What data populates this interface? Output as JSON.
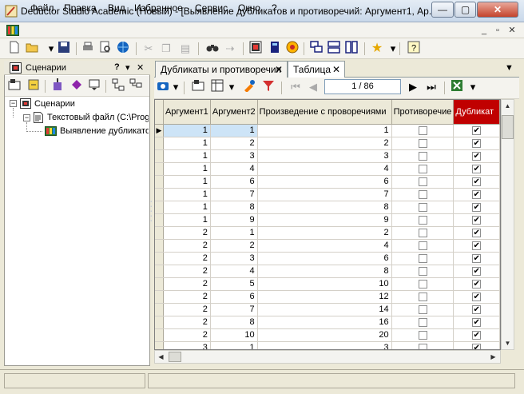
{
  "window": {
    "title": "Deductor Studio Academic (Новый) - [Выявление дубликатов и противоречий: Аргумент1, Ар...",
    "btn_min": "—",
    "btn_max": "▢",
    "btn_close": "✕"
  },
  "menu": [
    "Файл",
    "Правка",
    "Вид",
    "Избранное",
    "Сервис",
    "Окно",
    "?"
  ],
  "mdi_controls": [
    "_",
    "▫",
    "✕"
  ],
  "left_panel": {
    "title": "Сценарии",
    "controls": [
      "?",
      "▾",
      "✕"
    ],
    "tree": [
      {
        "label": "Сценарии",
        "expander": "⊟"
      },
      {
        "label": "Текстовый файл (C:\\Prog",
        "expander": "⊟"
      },
      {
        "label": "Выявление дубликатов"
      }
    ]
  },
  "tabs": [
    {
      "label": "Дубликаты и противоречия",
      "close": "✕"
    },
    {
      "label": "Таблица",
      "close": "✕"
    }
  ],
  "tabs_menu_icon": "▼",
  "pager": {
    "value": "1 / 86"
  },
  "grid": {
    "columns": [
      "Аргумент1",
      "Аргумент2",
      "Произведение с проворечиями",
      "Противоречие",
      "Дубликат"
    ],
    "rows": [
      {
        "a1": "1",
        "a2": "1",
        "p": "1",
        "contra": false,
        "dup": true
      },
      {
        "a1": "1",
        "a2": "2",
        "p": "2",
        "contra": false,
        "dup": true
      },
      {
        "a1": "1",
        "a2": "3",
        "p": "3",
        "contra": false,
        "dup": true
      },
      {
        "a1": "1",
        "a2": "4",
        "p": "4",
        "contra": false,
        "dup": true
      },
      {
        "a1": "1",
        "a2": "6",
        "p": "6",
        "contra": false,
        "dup": true
      },
      {
        "a1": "1",
        "a2": "7",
        "p": "7",
        "contra": false,
        "dup": true
      },
      {
        "a1": "1",
        "a2": "8",
        "p": "8",
        "contra": false,
        "dup": true
      },
      {
        "a1": "1",
        "a2": "9",
        "p": "9",
        "contra": false,
        "dup": true
      },
      {
        "a1": "2",
        "a2": "1",
        "p": "2",
        "contra": false,
        "dup": true
      },
      {
        "a1": "2",
        "a2": "2",
        "p": "4",
        "contra": false,
        "dup": true
      },
      {
        "a1": "2",
        "a2": "3",
        "p": "6",
        "contra": false,
        "dup": true
      },
      {
        "a1": "2",
        "a2": "4",
        "p": "8",
        "contra": false,
        "dup": true
      },
      {
        "a1": "2",
        "a2": "5",
        "p": "10",
        "contra": false,
        "dup": true
      },
      {
        "a1": "2",
        "a2": "6",
        "p": "12",
        "contra": false,
        "dup": true
      },
      {
        "a1": "2",
        "a2": "7",
        "p": "14",
        "contra": false,
        "dup": true
      },
      {
        "a1": "2",
        "a2": "8",
        "p": "16",
        "contra": false,
        "dup": true
      },
      {
        "a1": "2",
        "a2": "10",
        "p": "20",
        "contra": false,
        "dup": true
      },
      {
        "a1": "3",
        "a2": "1",
        "p": "3",
        "contra": false,
        "dup": true
      }
    ]
  },
  "icons": {
    "current_row": "▶",
    "check": "✔",
    "first": "⏮",
    "prev": "◀",
    "next": "▶",
    "last": "⏭",
    "scroll_up": "▲",
    "scroll_down": "▼",
    "scroll_left": "◀",
    "scroll_right": "▶"
  },
  "colors": {
    "duplicate_header": "#c00000",
    "selection": "#cde4f7"
  }
}
